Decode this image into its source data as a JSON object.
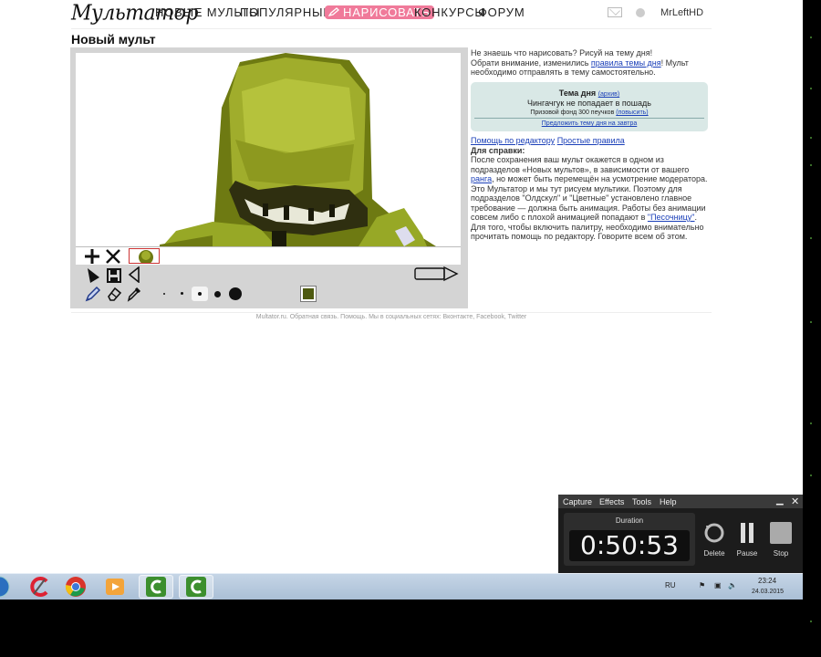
{
  "site": {
    "logo": "Мультатор",
    "nav": {
      "new": "Новые мульты",
      "popular": "Популярные",
      "draw": "Нарисовать",
      "contests": "Конкурсы",
      "forum": "Форум"
    },
    "username": "MrLeftHD"
  },
  "page_title": "Новый мульт",
  "sidebar": {
    "intro_1": "Не знаешь что нарисовать? Рисуй на тему дня!",
    "intro_2a": "Обрати внимание, изменились",
    "intro_link": "правила темы дня",
    "intro_2b": "! Мульт необходимо отправлять в тему самостоятельно.",
    "theme": {
      "title": "Тема дня",
      "archive_link": "(архив)",
      "text": "Чингачгук не попадает в пошадь",
      "prize": "Призовой фонд 300 пеучков",
      "raise_link": "(повысить)",
      "suggest_link": "Предложить тему дня на завтра"
    },
    "help_link": "Помощь по редактору",
    "rules_link": "Простые правила",
    "ref_title": "Для справки:",
    "ref_p1a": "После сохранения ваш мульт окажется в одном из подразделов «Новых мультов», в зависимости от вашего",
    "ref_p1_link": "ранга",
    "ref_p1b": ", но может быть перемещён на усмотрение модератора.",
    "ref_p2a": "Это Мультатор и мы тут рисуем мультики. Поэтому для подразделов \"Олдскул\" и \"Цветные\" установлено главное требование — должна быть анимация. Работы без анимации совсем либо с плохой анимацией попадают в",
    "ref_p2_link": "\"Песочницу\"",
    "ref_p2b": ".",
    "ref_p3": "Для того, чтобы включить палитру, необходимо внимательно прочитать помощь по редактору. Говорите всем об этом."
  },
  "editor": {
    "current_color": "#4e5a10",
    "tools": [
      "add-frame",
      "delete-frame",
      "play",
      "save",
      "back",
      "pencil",
      "eraser",
      "pipette"
    ],
    "brush_sizes": [
      "tiny",
      "small",
      "medium",
      "large",
      "xlarge"
    ]
  },
  "footer": "Multator.ru. Обратная связь. Помощь. Мы в социальных сетях: Вконтакте, Facebook, Twitter",
  "recorder": {
    "menu": [
      "Capture",
      "Effects",
      "Tools",
      "Help"
    ],
    "duration_label": "Duration",
    "time": "0:50:53",
    "delete": "Delete",
    "pause": "Pause",
    "stop": "Stop"
  },
  "taskbar": {
    "lang": "RU",
    "time": "23:24",
    "date": "24.03.2015"
  }
}
